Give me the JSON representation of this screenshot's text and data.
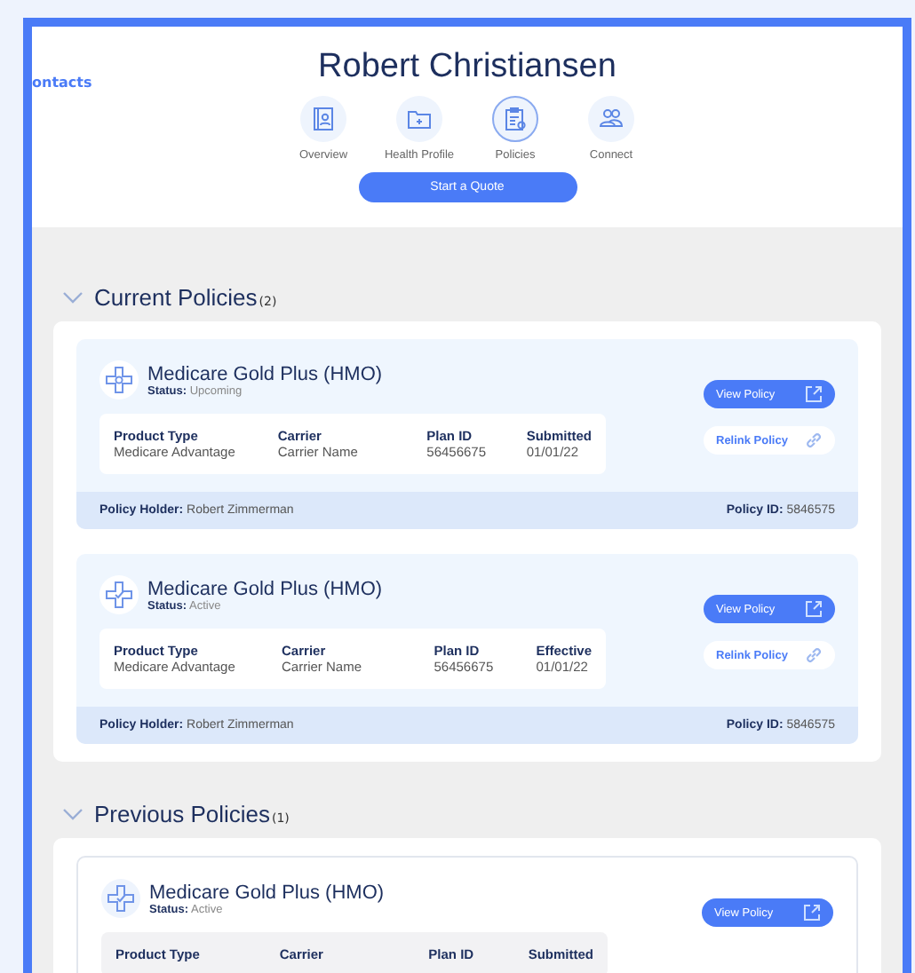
{
  "back_link": "ontacts",
  "title": "Robert Christiansen",
  "tabs": [
    {
      "label": "Overview",
      "selected": false
    },
    {
      "label": "Health Profile",
      "selected": false
    },
    {
      "label": "Policies",
      "selected": true
    },
    {
      "label": "Connect",
      "selected": false
    }
  ],
  "quote_button": "Start a Quote",
  "sections": [
    {
      "title": "Current Policies",
      "count": "(2)",
      "expanded": true,
      "policies": [
        {
          "name": "Medicare Gold Plus (HMO)",
          "status_label": "Status:",
          "status": "Upcoming",
          "kind": "current",
          "fields": [
            {
              "label": "Product Type",
              "value": "Medicare Advantage"
            },
            {
              "label": "Carrier",
              "value": "Carrier Name"
            },
            {
              "label": "Plan ID",
              "value": "56456675"
            },
            {
              "label": "Submitted",
              "value": "01/01/22"
            }
          ],
          "view_button": "View Policy",
          "relink_button": "Relink Policy",
          "holder_label": "Policy Holder:",
          "holder": "Robert Zimmerman",
          "policy_id_label": "Policy ID:",
          "policy_id": "5846575"
        },
        {
          "name": "Medicare Gold Plus (HMO)",
          "status_label": "Status:",
          "status": "Active",
          "kind": "current",
          "fields": [
            {
              "label": "Product Type",
              "value": "Medicare Advantage"
            },
            {
              "label": "Carrier",
              "value": "Carrier Name"
            },
            {
              "label": "Plan ID",
              "value": "56456675"
            },
            {
              "label": "Effective",
              "value": "01/01/22"
            }
          ],
          "view_button": "View Policy",
          "relink_button": "Relink Policy",
          "holder_label": "Policy Holder:",
          "holder": "Robert Zimmerman",
          "policy_id_label": "Policy ID:",
          "policy_id": "5846575"
        }
      ]
    },
    {
      "title": "Previous Policies",
      "count": "(1)",
      "expanded": true,
      "policies": [
        {
          "name": "Medicare Gold Plus (HMO)",
          "status_label": "Status:",
          "status": "Active",
          "kind": "previous",
          "fields": [
            {
              "label": "Product Type"
            },
            {
              "label": "Carrier"
            },
            {
              "label": "Plan ID"
            },
            {
              "label": "Submitted"
            }
          ],
          "view_button": "View Policy"
        }
      ]
    }
  ]
}
